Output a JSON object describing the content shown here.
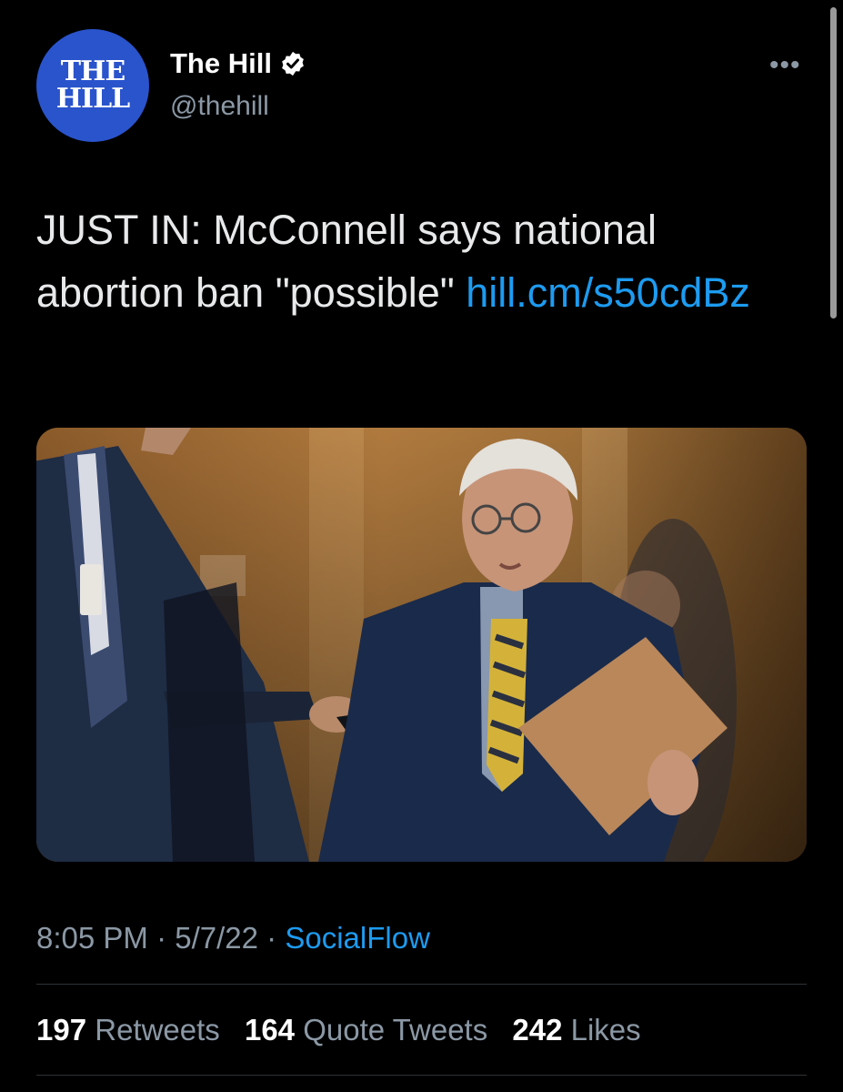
{
  "account": {
    "avatar_line1": "THE",
    "avatar_line2": "HILL",
    "display_name": "The Hill",
    "handle": "@thehill",
    "avatar_color": "#2a54cc"
  },
  "menu": {
    "more_icon": "more-dots-icon",
    "more_glyph": "•••"
  },
  "tweet": {
    "text": "JUST IN: McConnell says national abortion ban \"possible\" ",
    "link_text": "hill.cm/s50cdBz",
    "link_color": "#1d9bf0"
  },
  "meta": {
    "time": "8:05 PM",
    "separator": "·",
    "date": "5/7/22",
    "source": "SocialFlow"
  },
  "stats": {
    "retweets_count": "197",
    "retweets_label": "Retweets",
    "quotes_count": "164",
    "quotes_label": "Quote Tweets",
    "likes_count": "242",
    "likes_label": "Likes"
  }
}
